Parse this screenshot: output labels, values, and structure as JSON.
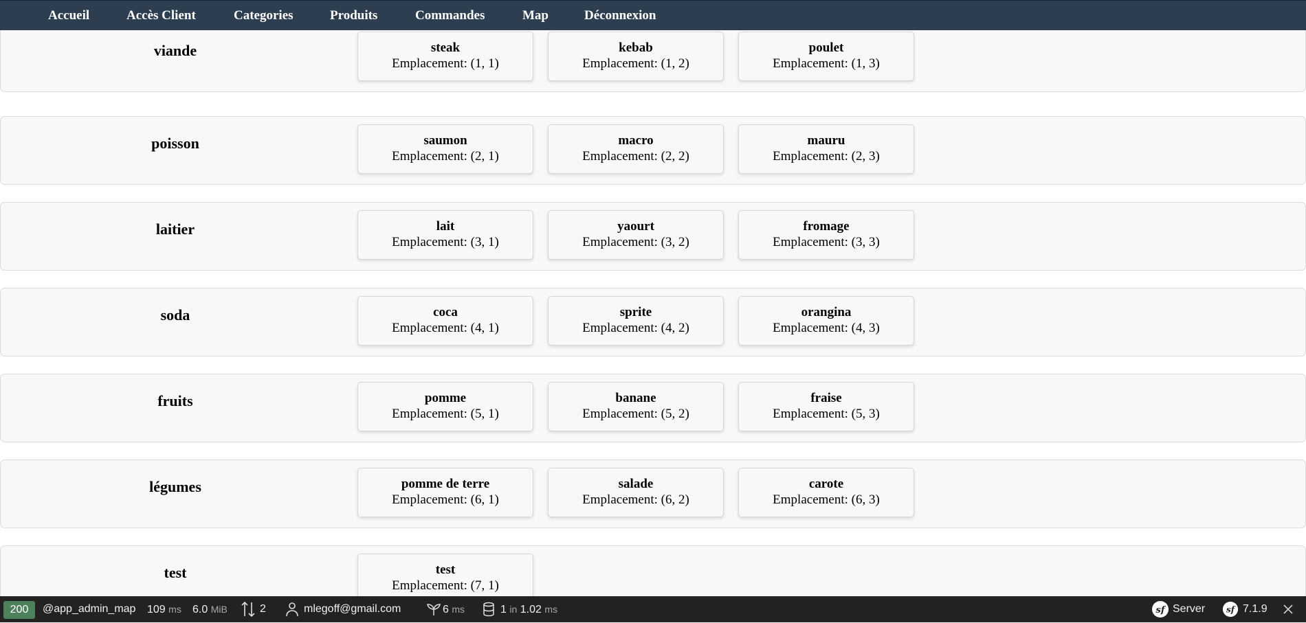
{
  "nav": {
    "items": [
      "Accueil",
      "Accès Client",
      "Categories",
      "Produits",
      "Commandes",
      "Map",
      "Déconnexion"
    ]
  },
  "categories": [
    {
      "name": "viande",
      "products": [
        {
          "name": "steak",
          "location": "Emplacement: (1, 1)"
        },
        {
          "name": "kebab",
          "location": "Emplacement: (1, 2)"
        },
        {
          "name": "poulet",
          "location": "Emplacement: (1, 3)"
        }
      ]
    },
    {
      "name": "poisson",
      "products": [
        {
          "name": "saumon",
          "location": "Emplacement: (2, 1)"
        },
        {
          "name": "macro",
          "location": "Emplacement: (2, 2)"
        },
        {
          "name": "mauru",
          "location": "Emplacement: (2, 3)"
        }
      ]
    },
    {
      "name": "laitier",
      "products": [
        {
          "name": "lait",
          "location": "Emplacement: (3, 1)"
        },
        {
          "name": "yaourt",
          "location": "Emplacement: (3, 2)"
        },
        {
          "name": "fromage",
          "location": "Emplacement: (3, 3)"
        }
      ]
    },
    {
      "name": "soda",
      "products": [
        {
          "name": "coca",
          "location": "Emplacement: (4, 1)"
        },
        {
          "name": "sprite",
          "location": "Emplacement: (4, 2)"
        },
        {
          "name": "orangina",
          "location": "Emplacement: (4, 3)"
        }
      ]
    },
    {
      "name": "fruits",
      "products": [
        {
          "name": "pomme",
          "location": "Emplacement: (5, 1)"
        },
        {
          "name": "banane",
          "location": "Emplacement: (5, 2)"
        },
        {
          "name": "fraise",
          "location": "Emplacement: (5, 3)"
        }
      ]
    },
    {
      "name": "légumes",
      "products": [
        {
          "name": "pomme de terre",
          "location": "Emplacement: (6, 1)"
        },
        {
          "name": "salade",
          "location": "Emplacement: (6, 2)"
        },
        {
          "name": "carote",
          "location": "Emplacement: (6, 3)"
        }
      ]
    },
    {
      "name": "test",
      "products": [
        {
          "name": "test",
          "location": "Emplacement: (7, 1)"
        }
      ]
    }
  ],
  "toolbar": {
    "status_code": "200",
    "route": "@app_admin_map",
    "time_value": "109",
    "time_unit": "ms",
    "memory_value": "6.0",
    "memory_unit": "MiB",
    "requests_count": "2",
    "user": "mlegoff@gmail.com",
    "twig_value": "6",
    "twig_unit": "ms",
    "db_queries": "1",
    "db_in": "in",
    "db_time": "1.02",
    "db_unit": "ms",
    "server_label": "Server",
    "version": "7.1.9",
    "icons": [
      "user-icon",
      "leaf-icon",
      "database-icon",
      "symfony-logo-icon",
      "close-icon"
    ],
    "colors": {
      "status": "#4f805d",
      "background": "#222222",
      "navbar": "#2c3e50"
    }
  }
}
